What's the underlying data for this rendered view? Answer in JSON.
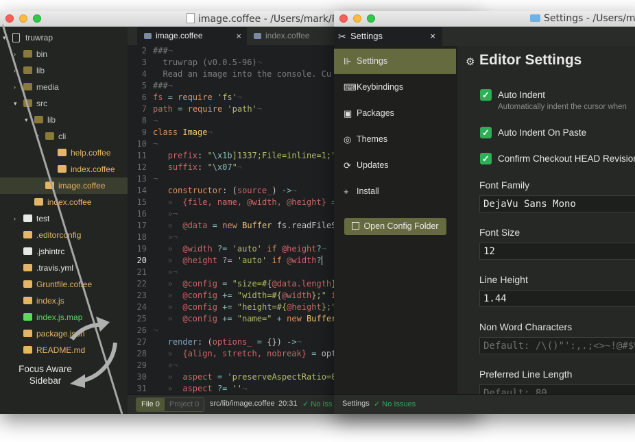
{
  "left_window": {
    "title": "image.coffee - /Users/mark/Proje",
    "tree": [
      {
        "label": "truwrap",
        "kind": "repo",
        "arrow": "▾",
        "color": "#c5c8c6"
      },
      {
        "label": "bin",
        "kind": "folder",
        "arrow": "›",
        "color": "#c5c8c6"
      },
      {
        "label": "lib",
        "kind": "folder",
        "arrow": "›",
        "color": "#c5c8c6"
      },
      {
        "label": "media",
        "kind": "folder",
        "arrow": "›",
        "color": "#c5c8c6"
      },
      {
        "label": "src",
        "kind": "folder",
        "arrow": "▾",
        "color": "#c5c8c6"
      },
      {
        "label": "lib",
        "kind": "folder",
        "arrow": "▾",
        "color": "#c5c8c6"
      },
      {
        "label": "cli",
        "kind": "folder",
        "arrow": "▾",
        "color": "#c5c8c6"
      },
      {
        "label": "help.coffee",
        "kind": "file",
        "arrow": "",
        "color": "#e5b567"
      },
      {
        "label": "index.coffee",
        "kind": "file",
        "arrow": "",
        "color": "#e5b567"
      },
      {
        "label": "image.coffee",
        "kind": "file",
        "arrow": "",
        "color": "#e5b567"
      },
      {
        "label": "index.coffee",
        "kind": "file",
        "arrow": "",
        "color": "#e5b567"
      },
      {
        "label": "test",
        "kind": "folder-white",
        "arrow": "›",
        "color": "#e8e8e8"
      },
      {
        "label": ".editorconfig",
        "kind": "gear",
        "arrow": "",
        "color": "#e5b567"
      },
      {
        "label": ".jshintrc",
        "kind": "gear-white",
        "arrow": "",
        "color": "#e8e8e8"
      },
      {
        "label": ".travis.yml",
        "kind": "file",
        "arrow": "",
        "color": "#e8e8e8"
      },
      {
        "label": "Gruntfile.coffee",
        "kind": "grunt",
        "arrow": "",
        "color": "#e5b567"
      },
      {
        "label": "index.js",
        "kind": "js",
        "arrow": "",
        "color": "#e5b567"
      },
      {
        "label": "index.js.map",
        "kind": "map",
        "arrow": "",
        "color": "#5fd65f"
      },
      {
        "label": "package.json",
        "kind": "json",
        "arrow": "",
        "color": "#e5b567"
      },
      {
        "label": "README.md",
        "kind": "md",
        "arrow": "",
        "color": "#e5b567"
      }
    ],
    "tabs": [
      {
        "label": "image.coffee",
        "active": true,
        "close": "×"
      },
      {
        "label": "index.coffee",
        "active": false,
        "close": ""
      }
    ],
    "line_numbers": [
      "2",
      "3",
      "4",
      "5",
      "6",
      "7",
      "8",
      "9",
      "10",
      "11",
      "12",
      "13",
      "14",
      "15",
      "16",
      "17",
      "18",
      "19",
      "20",
      "21",
      "22",
      "23",
      "24",
      "25",
      "26",
      "27",
      "28",
      "29",
      "30",
      "31"
    ],
    "current_line": "20",
    "status": {
      "file_btn": "File 0",
      "project_btn": "Project 0",
      "path": "src/lib/image.coffee",
      "cursor": "20:31",
      "issues": "✓ No Iss"
    }
  },
  "right_window": {
    "title": "Settings - /Users/mark",
    "tab_label": "Settings",
    "tab_close": "×",
    "nav": [
      {
        "label": "Settings",
        "icon": "⊪",
        "active": true
      },
      {
        "label": "Keybindings",
        "icon": "⌨",
        "active": false
      },
      {
        "label": "Packages",
        "icon": "▣",
        "active": false
      },
      {
        "label": "Themes",
        "icon": "◎",
        "active": false
      },
      {
        "label": "Updates",
        "icon": "⟳",
        "active": false
      },
      {
        "label": "Install",
        "icon": "+",
        "active": false
      }
    ],
    "open_config_button": "Open Config Folder",
    "panel_title": "Editor Settings",
    "checkboxes": [
      {
        "label": "Auto Indent",
        "description": "Automatically indent the cursor when",
        "checked": true
      },
      {
        "label": "Auto Indent On Paste",
        "description": "",
        "checked": true
      },
      {
        "label": "Confirm Checkout HEAD Revision",
        "description": "",
        "checked": true
      }
    ],
    "fields": [
      {
        "label": "Font Family",
        "value": "DejaVu Sans Mono",
        "placeholder": false
      },
      {
        "label": "Font Size",
        "value": "12",
        "placeholder": false
      },
      {
        "label": "Line Height",
        "value": "1.44",
        "placeholder": false
      },
      {
        "label": "Non Word Characters",
        "value": "Default: /\\()\"':,.;<>~!@#$%",
        "placeholder": true
      },
      {
        "label": "Preferred Line Length",
        "value": "Default: 80",
        "placeholder": true
      }
    ],
    "status": {
      "label": "Settings",
      "issues": "✓ No Issues"
    }
  },
  "annotation": {
    "line1": "Focus Aware",
    "line2": "Sidebar"
  }
}
